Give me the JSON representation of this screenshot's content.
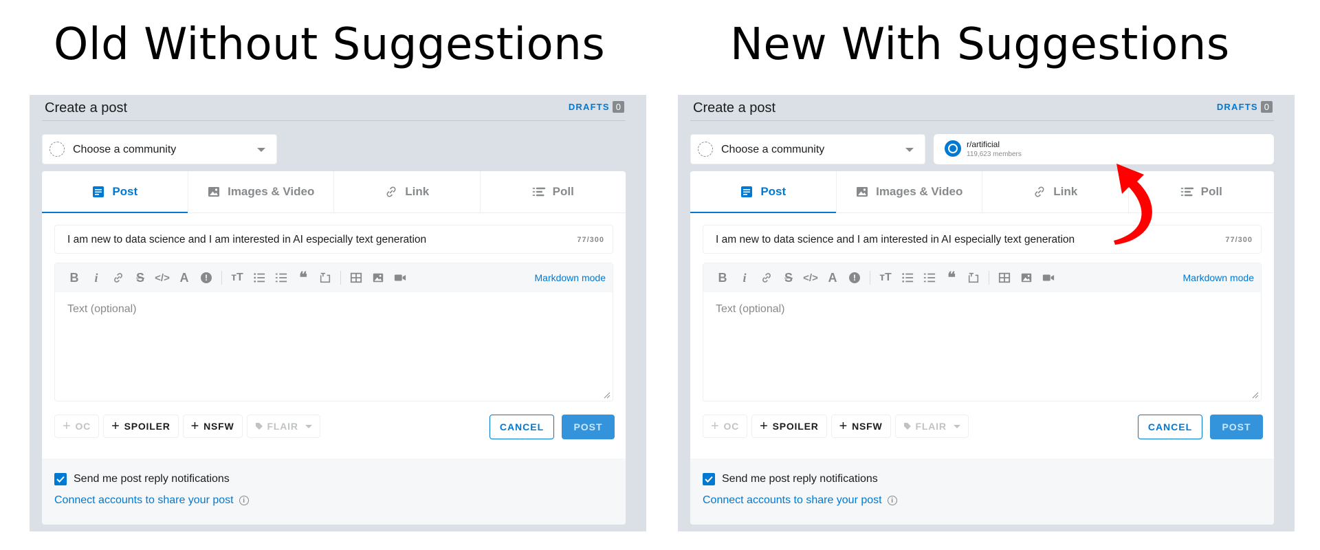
{
  "headings": {
    "left": "Old Without Suggestions",
    "right": "New With Suggestions"
  },
  "panel": {
    "title": "Create a post",
    "drafts_label": "DRAFTS",
    "drafts_count": "0",
    "community_label": "Choose a community",
    "suggestion": {
      "name": "r/artificial",
      "members": "119,623 members"
    },
    "tabs": [
      {
        "label": "Post",
        "icon": "post-icon",
        "active": true
      },
      {
        "label": "Images & Video",
        "icon": "image-icon"
      },
      {
        "label": "Link",
        "icon": "link-icon"
      },
      {
        "label": "Poll",
        "icon": "poll-icon"
      }
    ],
    "title_value": "I am new to data science and I am interested in AI especially text generation",
    "title_count": "77/300",
    "markdown_mode": "Markdown mode",
    "text_placeholder": "Text (optional)",
    "chips": {
      "oc": "OC",
      "spoiler": "SPOILER",
      "nsfw": "NSFW",
      "flair": "FLAIR"
    },
    "cancel_label": "CANCEL",
    "post_label": "POST",
    "notify_label": "Send me post reply notifications",
    "connect_label": "Connect accounts to share your post",
    "info_glyph": "i",
    "toolbar": {
      "bold": "B",
      "italic": "i",
      "link": "link-icon",
      "strike": "S",
      "code": "</>",
      "superscript": "A",
      "spoiler": "!",
      "heading": "тT",
      "bullets": "bullet-list-icon",
      "numbered": "numbered-list-icon",
      "quote": "❝",
      "codeblock": "code-block-icon",
      "table": "table-icon",
      "image": "image-icon",
      "video": "video-icon"
    }
  },
  "colors": {
    "accent": "#0079d3",
    "panel_bg": "#dae0e6",
    "arrow": "#ff0000"
  }
}
